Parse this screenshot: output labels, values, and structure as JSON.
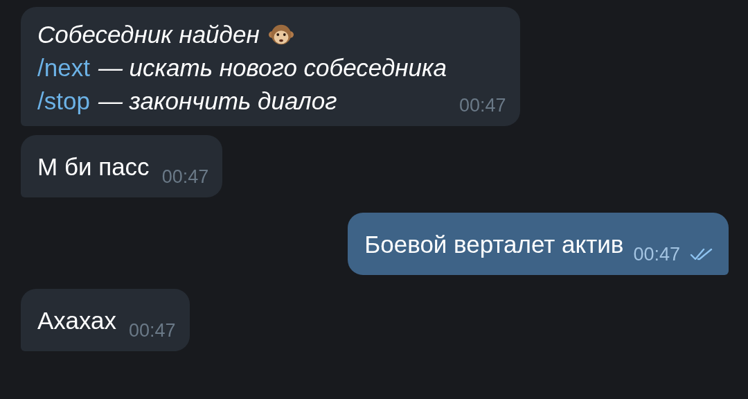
{
  "messages": [
    {
      "kind": "bot",
      "title": "Собеседник найден",
      "commands": [
        {
          "command": "/next",
          "description": "— искать нового собеседника"
        },
        {
          "command": "/stop",
          "description": "— закончить диалог"
        }
      ],
      "time": "00:47"
    },
    {
      "kind": "incoming",
      "text": "М би пасс",
      "time": "00:47"
    },
    {
      "kind": "outgoing",
      "text": "Боевой верталет актив",
      "time": "00:47",
      "read": true
    },
    {
      "kind": "incoming",
      "text": "Ахахах",
      "time": "00:47"
    }
  ]
}
